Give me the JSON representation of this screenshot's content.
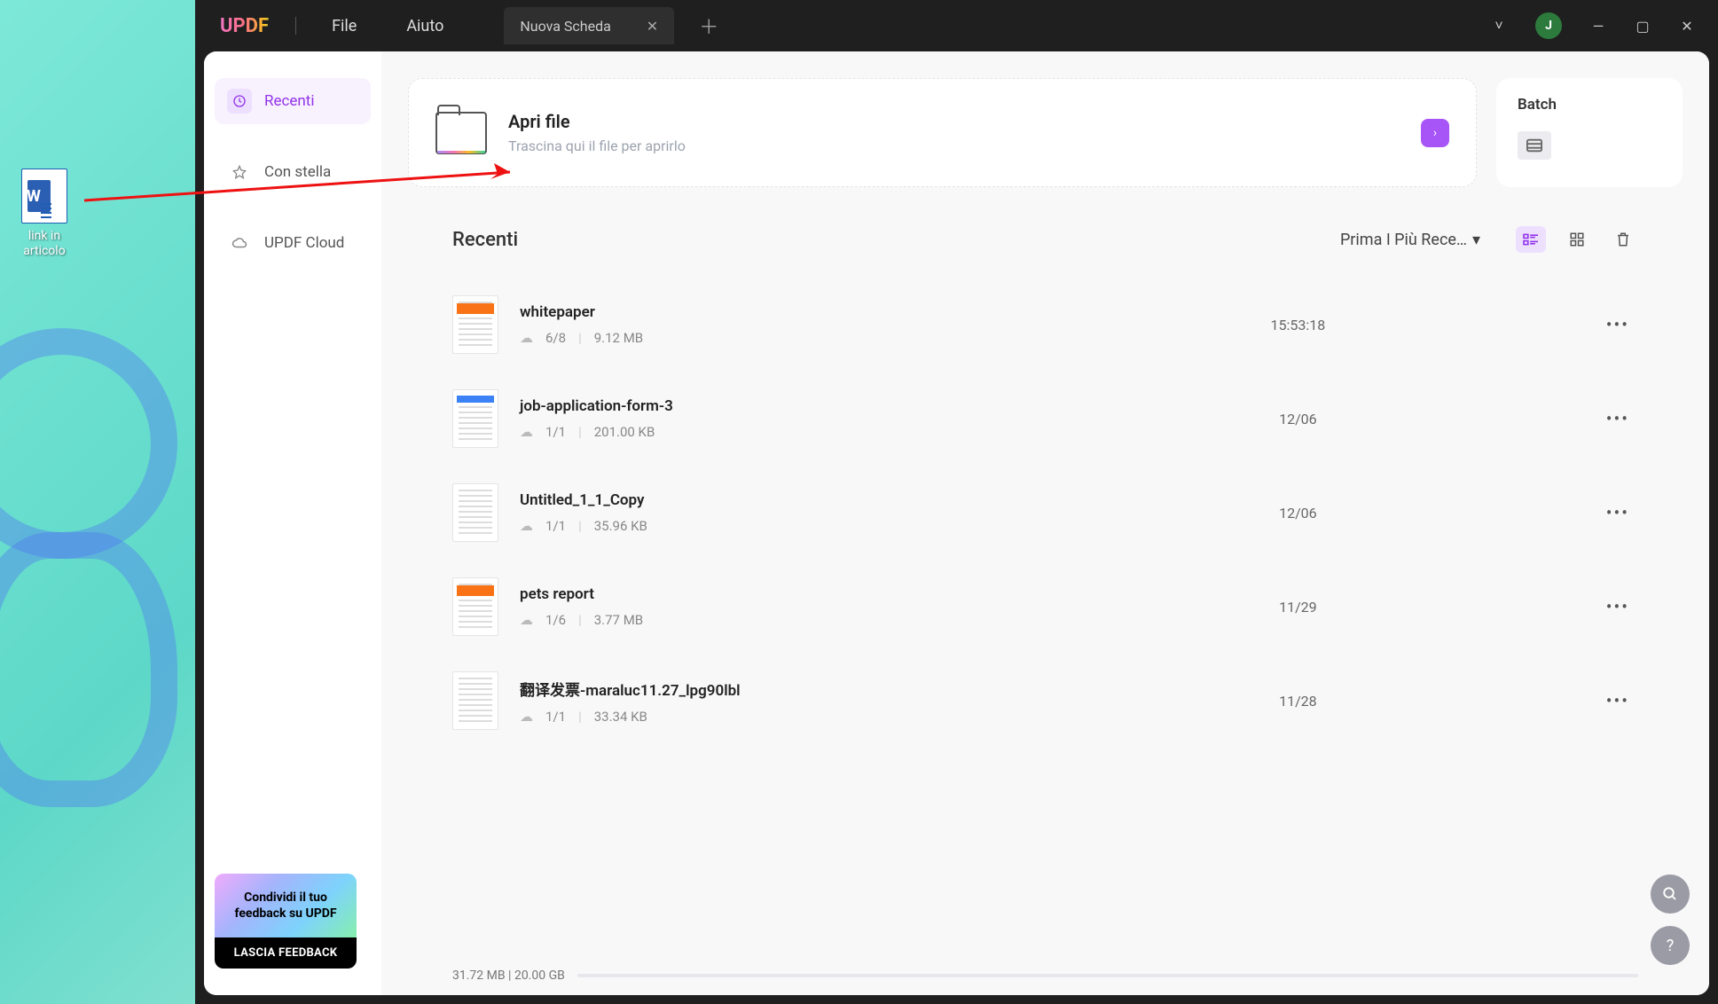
{
  "desktop": {
    "icon_label": "link in\narticolo",
    "icon_letter": "W"
  },
  "titlebar": {
    "logo": "UPDF",
    "menu": {
      "file": "File",
      "help": "Aiuto"
    },
    "tab_label": "Nuova Scheda",
    "avatar": "J"
  },
  "sidebar": {
    "items": [
      {
        "label": "Recenti",
        "icon": "clock",
        "active": true
      },
      {
        "label": "Con stella",
        "icon": "star",
        "active": false
      },
      {
        "label": "UPDF Cloud",
        "icon": "cloud",
        "active": false
      }
    ],
    "feedback": {
      "top": "Condividi il tuo feedback su UPDF",
      "button": "LASCIA FEEDBACK"
    }
  },
  "main": {
    "open_file": {
      "title": "Apri file",
      "subtitle": "Trascina qui il file per aprirlo"
    },
    "batch": {
      "title": "Batch"
    },
    "recent": {
      "title": "Recenti",
      "sort_label": "Prima I Più Rece…",
      "items": [
        {
          "name": "whitepaper",
          "pages": "6/8",
          "size": "9.12 MB",
          "date": "15:53:18",
          "thumb": "orange"
        },
        {
          "name": "job-application-form-3",
          "pages": "1/1",
          "size": "201.00 KB",
          "date": "12/06",
          "thumb": "blue"
        },
        {
          "name": "Untitled_1_1_Copy",
          "pages": "1/1",
          "size": "35.96 KB",
          "date": "12/06",
          "thumb": "plain"
        },
        {
          "name": "pets report",
          "pages": "1/6",
          "size": "3.77 MB",
          "date": "11/29",
          "thumb": "orange"
        },
        {
          "name": "翻译发票-maraluc11.27_lpg90lbl",
          "pages": "1/1",
          "size": "33.34 KB",
          "date": "11/28",
          "thumb": "plain"
        }
      ]
    },
    "storage": "31.72 MB | 20.00 GB"
  }
}
